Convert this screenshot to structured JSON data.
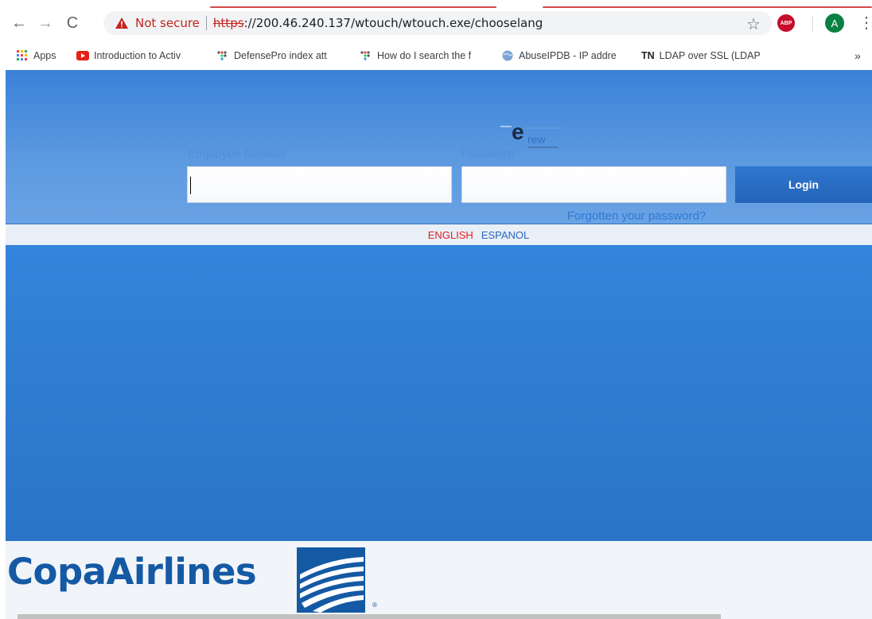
{
  "browser": {
    "nav": {
      "back": "←",
      "forward": "→",
      "reload": "C"
    },
    "security_label": "Not secure",
    "url_scheme": "https",
    "url_rest": "://200.46.240.137/wtouch/wtouch.exe/chooselang",
    "star": "☆",
    "abp_label": "ABP",
    "avatar_initial": "A",
    "menu": "⋮",
    "bookmarks": [
      {
        "label": "Apps",
        "icon": "apps-grid-icon"
      },
      {
        "label": "Introduction to Activ",
        "icon": "youtube-icon"
      },
      {
        "label": "DefensePro index att",
        "icon": "dots-icon"
      },
      {
        "label": "How do I search the f",
        "icon": "dots-icon"
      },
      {
        "label": "AbuseIPDB - IP addre",
        "icon": "globe-icon"
      },
      {
        "label": "LDAP over SSL (LDAP",
        "icon": "tn-icon",
        "prefix": "TN"
      }
    ],
    "more": "»"
  },
  "login": {
    "employee_label": "Employee Number",
    "password_label": "Password",
    "login_button": "Login",
    "forgot_link": "Forgotten your password?",
    "logo_text": "e",
    "logo_sub": "rew"
  },
  "language": {
    "english": "ENGLISH",
    "spanish": "ESPANOL"
  },
  "footer": {
    "brand": "CopaAirlines",
    "registered": "®"
  },
  "colors": {
    "accent": "#3a82d9",
    "brand": "#1459a4",
    "english": "#e41c23"
  }
}
